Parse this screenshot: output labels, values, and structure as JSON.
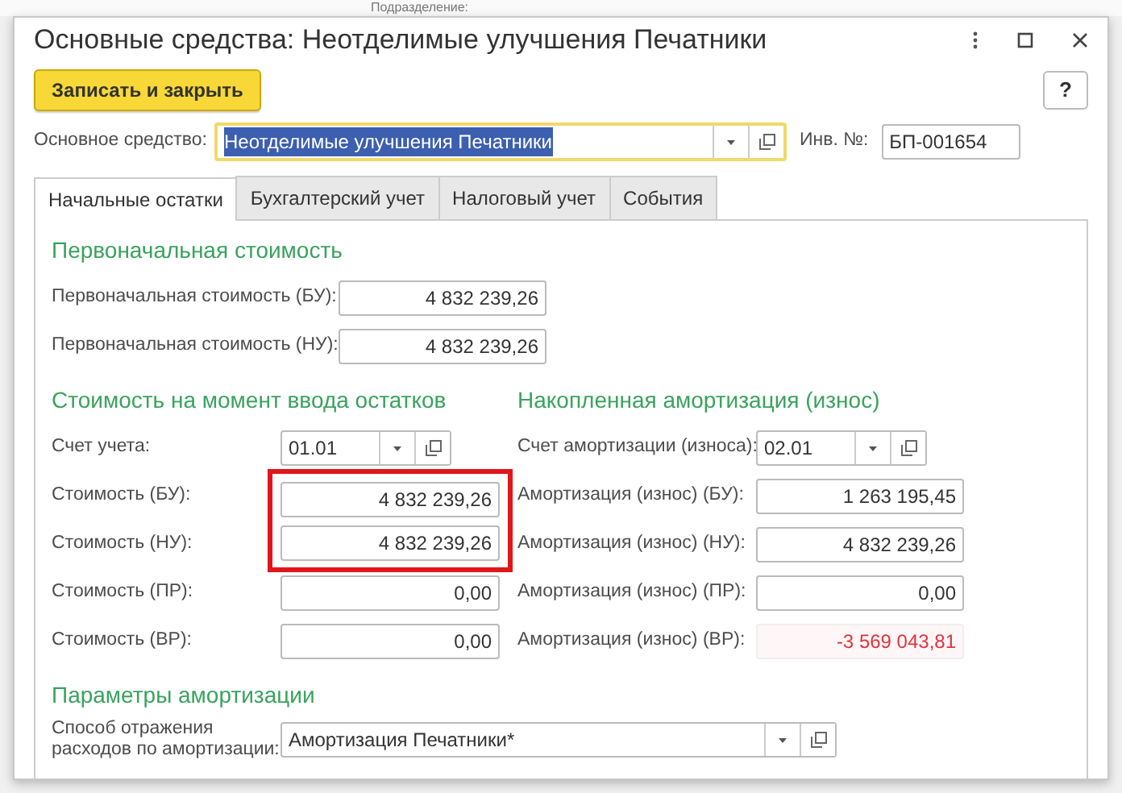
{
  "background_label": "Подразделение:",
  "window": {
    "title": "Основные средства: Неотделимые улучшения Печатники"
  },
  "toolbar": {
    "save_button": "Записать и закрыть",
    "help_button": "?"
  },
  "main_field": {
    "label": "Основное средство:",
    "value": "Неотделимые улучшения Печатники",
    "focused": true
  },
  "inventory": {
    "label": "Инв. №:",
    "value": "БП-001654"
  },
  "tabs": [
    {
      "label": "Начальные остатки",
      "selected": true
    },
    {
      "label": "Бухгалтерский учет",
      "selected": false
    },
    {
      "label": "Налоговый учет",
      "selected": false
    },
    {
      "label": "События",
      "selected": false
    }
  ],
  "initial_cost": {
    "title": "Первоначальная стоимость",
    "fields": [
      {
        "label": "Первоначальная стоимость (БУ):",
        "value": "4 832 239,26"
      },
      {
        "label": "Первоначальная стоимость (НУ):",
        "value": "4 832 239,26"
      }
    ]
  },
  "balance": {
    "title": "Стоимость на момент ввода остатков",
    "fields": [
      {
        "kind": "select",
        "label": "Счет учета:",
        "value": "01.01"
      },
      {
        "kind": "number",
        "label": "Стоимость (БУ):",
        "value": "4 832 239,26",
        "highlighted": true,
        "negative": false
      },
      {
        "kind": "number",
        "label": "Стоимость (НУ):",
        "value": "4 832 239,26",
        "highlighted": true,
        "negative": false
      },
      {
        "kind": "number",
        "label": "Стоимость (ПР):",
        "value": "0,00",
        "highlighted": false,
        "negative": false
      },
      {
        "kind": "number",
        "label": "Стоимость (ВР):",
        "value": "0,00",
        "highlighted": false,
        "negative": false
      }
    ]
  },
  "depreciation": {
    "title": "Накопленная амортизация (износ)",
    "fields": [
      {
        "kind": "select",
        "label": "Счет амортизации (износа):",
        "value": "02.01"
      },
      {
        "kind": "number",
        "label": "Амортизация (износ) (БУ):",
        "value": "1 263 195,45",
        "highlighted": false,
        "negative": false
      },
      {
        "kind": "number",
        "label": "Амортизация (износ) (НУ):",
        "value": "4 832 239,26",
        "highlighted": false,
        "negative": false
      },
      {
        "kind": "number",
        "label": "Амортизация (износ) (ПР):",
        "value": "0,00",
        "highlighted": false,
        "negative": false
      },
      {
        "kind": "number",
        "label": "Амортизация (износ) (ВР):",
        "value": "-3 569 043,81",
        "highlighted": false,
        "negative": true
      }
    ]
  },
  "parameters": {
    "title": "Параметры амортизации",
    "field": {
      "label": "Способ отражения расходов по амортизации:",
      "value": "Амортизация Печатники*"
    }
  }
}
